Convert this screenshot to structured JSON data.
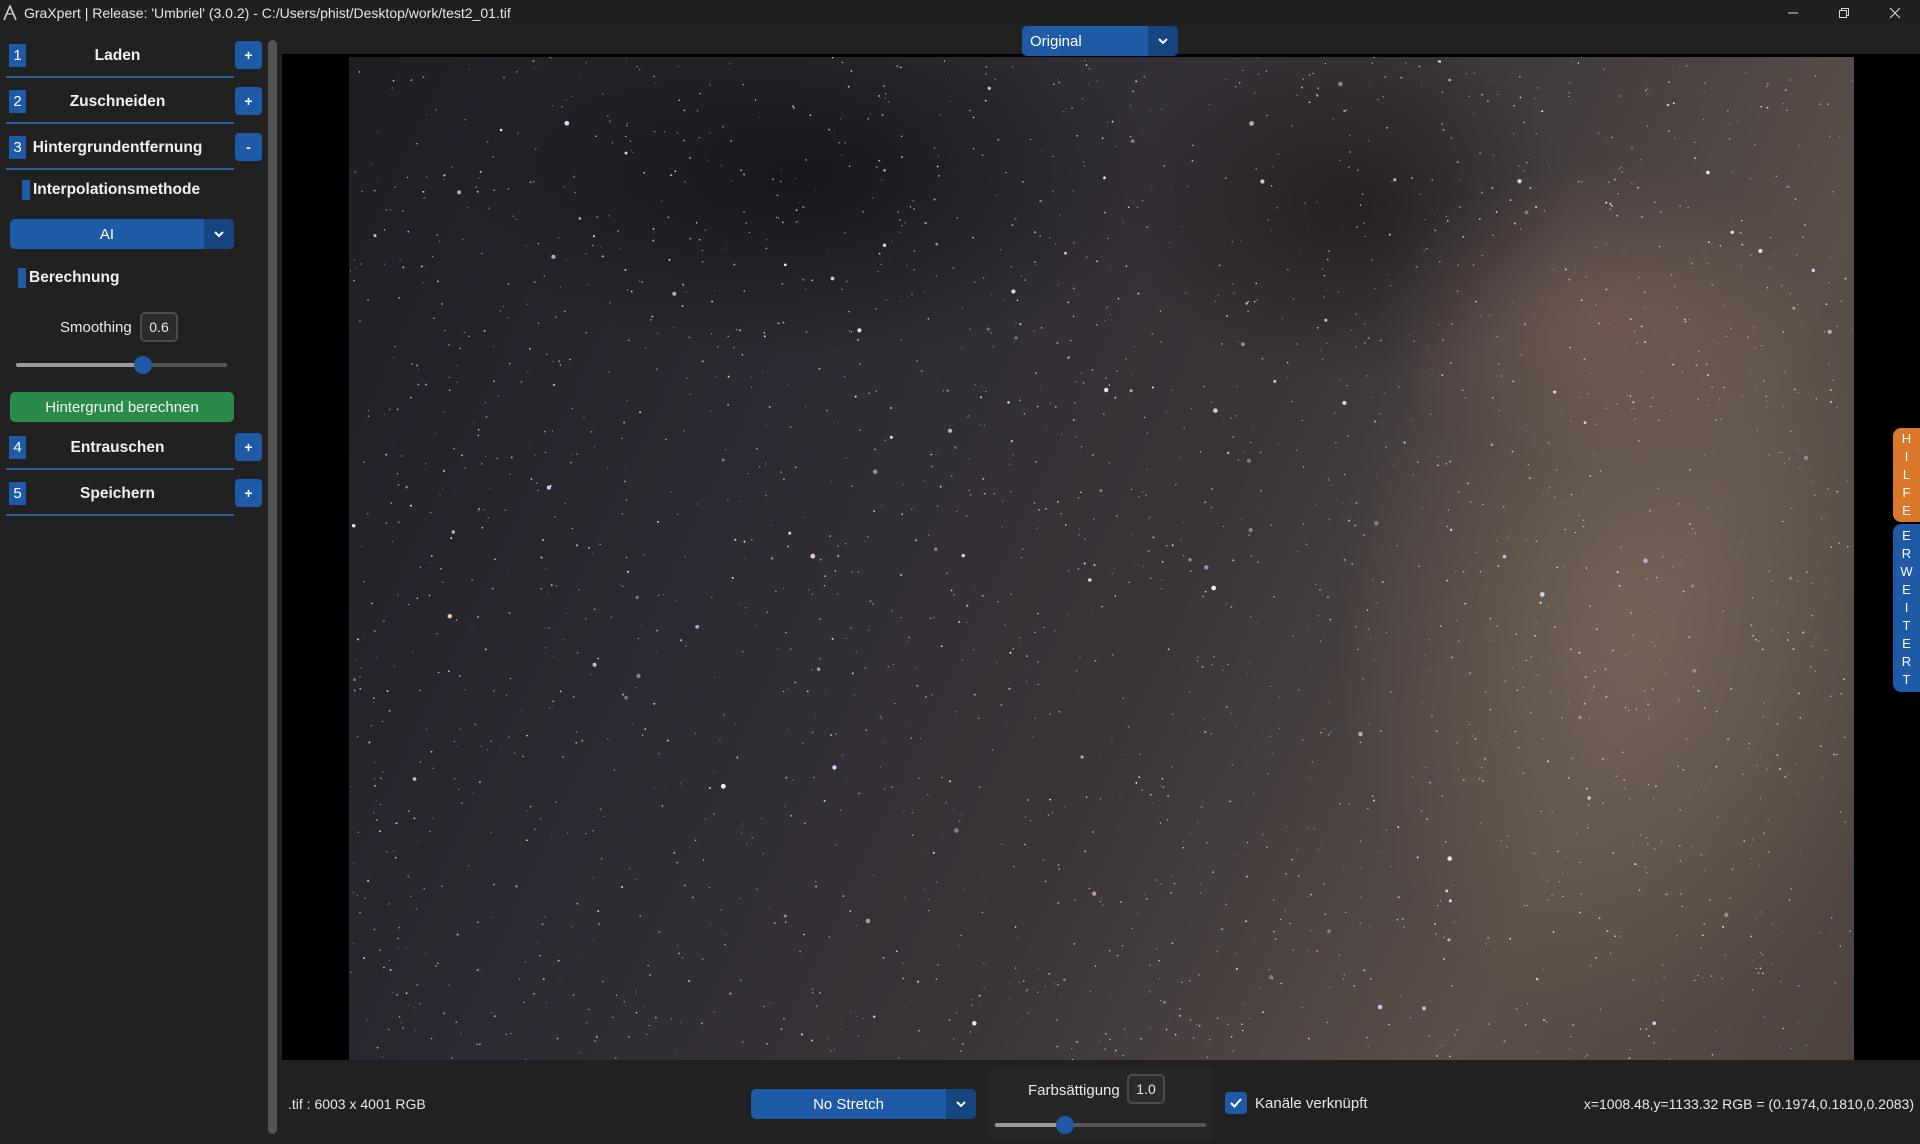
{
  "window": {
    "title": "GraXpert | Release: 'Umbriel' (3.0.2) - C:/Users/phist/Desktop/work/test2_01.tif",
    "app_icon": "graxpert-logo-icon",
    "controls": [
      "minimize-icon",
      "restore-icon",
      "close-icon"
    ]
  },
  "sidebar": {
    "steps": [
      {
        "num": "1",
        "label": "Laden",
        "toggle": "+"
      },
      {
        "num": "2",
        "label": "Zuschneiden",
        "toggle": "+"
      },
      {
        "num": "3",
        "label": "Hintergrundentfernung",
        "toggle": "-"
      },
      {
        "num": "4",
        "label": "Entrauschen",
        "toggle": "+"
      },
      {
        "num": "5",
        "label": "Speichern",
        "toggle": "+"
      }
    ],
    "interpolation": {
      "heading": "Interpolationsmethode",
      "selected": "AI"
    },
    "calculation": {
      "heading": "Berechnung",
      "smoothing_label": "Smoothing",
      "smoothing_value": "0.6",
      "smoothing_slider_fraction": 0.6,
      "button": "Hintergrund berechnen"
    }
  },
  "view": {
    "display_mode": "Original"
  },
  "side_tabs": {
    "help": "HILFE",
    "advanced": "ERWEITERT"
  },
  "statusbar": {
    "file_info": ".tif : 6003 x 4001 RGB",
    "stretch": "No Stretch",
    "saturation_label": "Farbsättigung",
    "saturation_value": "1.0",
    "saturation_slider_fraction": 0.33,
    "channels_linked_label": "Kanäle verknüpft",
    "channels_linked_checked": true,
    "coordinates": "x=1008.48,y=1133.32  RGB = (0.1974,0.1810,0.2083)"
  },
  "colors": {
    "accent_blue": "#1f5aa6",
    "green_button": "#2a8a4c",
    "help_orange": "#d9782a",
    "background": "#212121"
  }
}
